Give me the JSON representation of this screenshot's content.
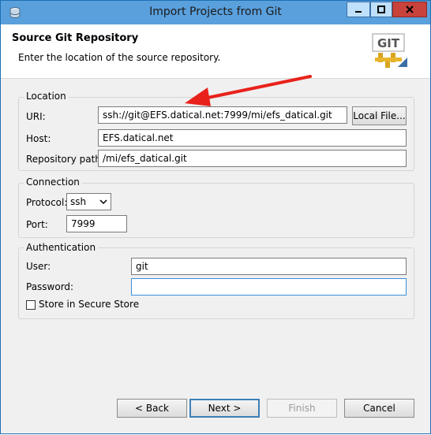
{
  "window": {
    "title": "Import Projects from Git",
    "icon": "database-icon",
    "controls": [
      "minimize",
      "maximize",
      "close"
    ]
  },
  "header": {
    "title": "Source Git Repository",
    "description": "Enter the location of the source repository.",
    "logo_text": "GIT"
  },
  "location": {
    "group_label": "Location",
    "uri_label": "URI:",
    "uri_value": "ssh://git@EFS.datical.net:7999/mi/efs_datical.git",
    "local_file_button": "Local File...",
    "host_label": "Host:",
    "host_value": "EFS.datical.net",
    "repo_path_label": "Repository path:",
    "repo_path_value": "/mi/efs_datical.git"
  },
  "connection": {
    "group_label": "Connection",
    "protocol_label": "Protocol:",
    "protocol_value": "ssh",
    "port_label": "Port:",
    "port_value": "7999"
  },
  "authentication": {
    "group_label": "Authentication",
    "user_label": "User:",
    "user_value": "git",
    "password_label": "Password:",
    "password_value": "",
    "store_label": "Store in Secure Store",
    "store_checked": false
  },
  "footer": {
    "back": "< Back",
    "next": "Next >",
    "finish": "Finish",
    "cancel": "Cancel"
  },
  "colors": {
    "titlebar": "#5aa0dc",
    "arrow": "#e8221b",
    "close_button": "#c7433b"
  }
}
